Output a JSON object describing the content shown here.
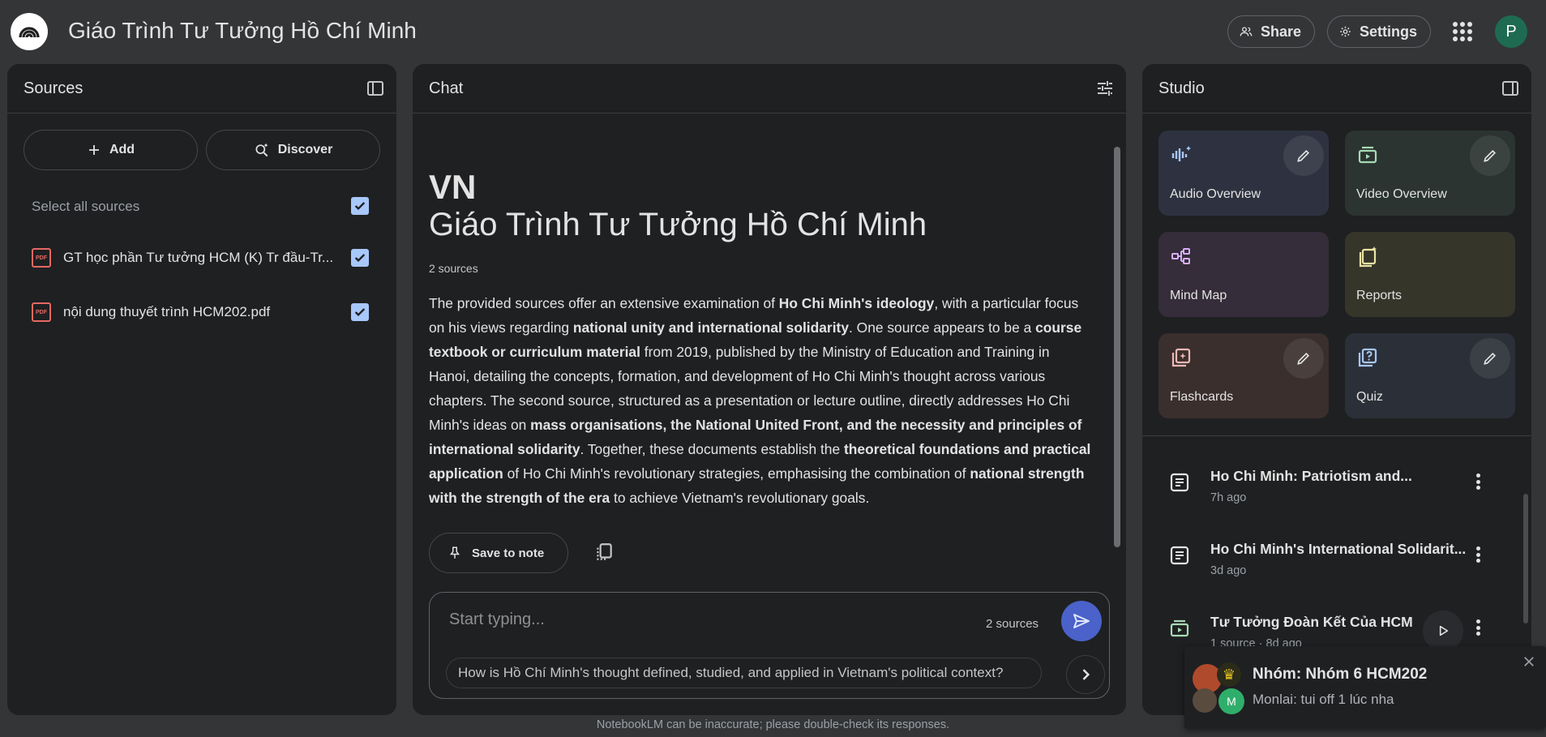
{
  "header": {
    "title": "Giáo Trình Tư Tưởng Hồ Chí Minh",
    "share_label": "Share",
    "settings_label": "Settings",
    "avatar_letter": "P"
  },
  "sources": {
    "title": "Sources",
    "add_label": "Add",
    "discover_label": "Discover",
    "select_all": "Select all sources",
    "items": [
      {
        "name": "GT học phần Tư tưởng HCM (K) Tr đầu-Tr...",
        "checked": true
      },
      {
        "name": "nội dung thuyết trình HCM202.pdf",
        "checked": true
      }
    ]
  },
  "chat": {
    "title": "Chat",
    "emoji": "VN",
    "notebook_title": "Giáo Trình Tư Tưởng Hồ Chí Minh",
    "source_count": "2 sources",
    "summary": [
      {
        "t": "The provided sources offer an extensive examination of ",
        "b": false
      },
      {
        "t": "Ho Chi Minh's ideology",
        "b": true
      },
      {
        "t": ", with a particular focus on his views regarding ",
        "b": false
      },
      {
        "t": "national unity and international solidarity",
        "b": true
      },
      {
        "t": ". One source appears to be a ",
        "b": false
      },
      {
        "t": "course textbook or curriculum material",
        "b": true
      },
      {
        "t": " from 2019, published by the Ministry of Education and Training in Hanoi, detailing the concepts, formation, and development of Ho Chi Minh's thought across various chapters. The second source, structured as a presentation or lecture outline, directly addresses Ho Chi Minh's ideas on ",
        "b": false
      },
      {
        "t": "mass organisations, the National United Front, and the necessity and principles of international solidarity",
        "b": true
      },
      {
        "t": ". Together, these documents establish the ",
        "b": false
      },
      {
        "t": "theoretical foundations and practical application",
        "b": true
      },
      {
        "t": " of Ho Chi Minh's revolutionary strategies, emphasising the combination of ",
        "b": false
      },
      {
        "t": "national strength with the strength of the era",
        "b": true
      },
      {
        "t": " to achieve Vietnam's revolutionary goals.",
        "b": false
      }
    ],
    "save_note_label": "Save to note",
    "input_placeholder": "Start typing...",
    "input_sources": "2 sources",
    "suggestion": "How is Hồ Chí Minh's thought defined, studied, and applied in Vietnam's political context?"
  },
  "studio": {
    "title": "Studio",
    "tiles": {
      "audio": "Audio Overview",
      "video": "Video Overview",
      "mindmap": "Mind Map",
      "reports": "Reports",
      "flashcards": "Flashcards",
      "quiz": "Quiz"
    },
    "notes": [
      {
        "title": "Ho Chi Minh: Patriotism and...",
        "meta": "7h ago"
      },
      {
        "title": "Ho Chi Minh's International Solidarit...",
        "meta": "3d ago"
      },
      {
        "title": "Tư Tưởng Đoàn Kết Của HCM",
        "meta": "1 source · 8d ago"
      }
    ]
  },
  "notification": {
    "title": "Nhóm: Nhóm 6 HCM202",
    "message": "Monlai: tui off 1 lúc nha",
    "avatar_letter": "M"
  },
  "footer": "NotebookLM can be inaccurate; please double-check its responses.",
  "colors": {
    "background": "#333537",
    "panel": "#1f2022",
    "accent_blue": "#a8c7fa",
    "send_button": "#4a62c9",
    "pdf_red": "#e46962"
  }
}
